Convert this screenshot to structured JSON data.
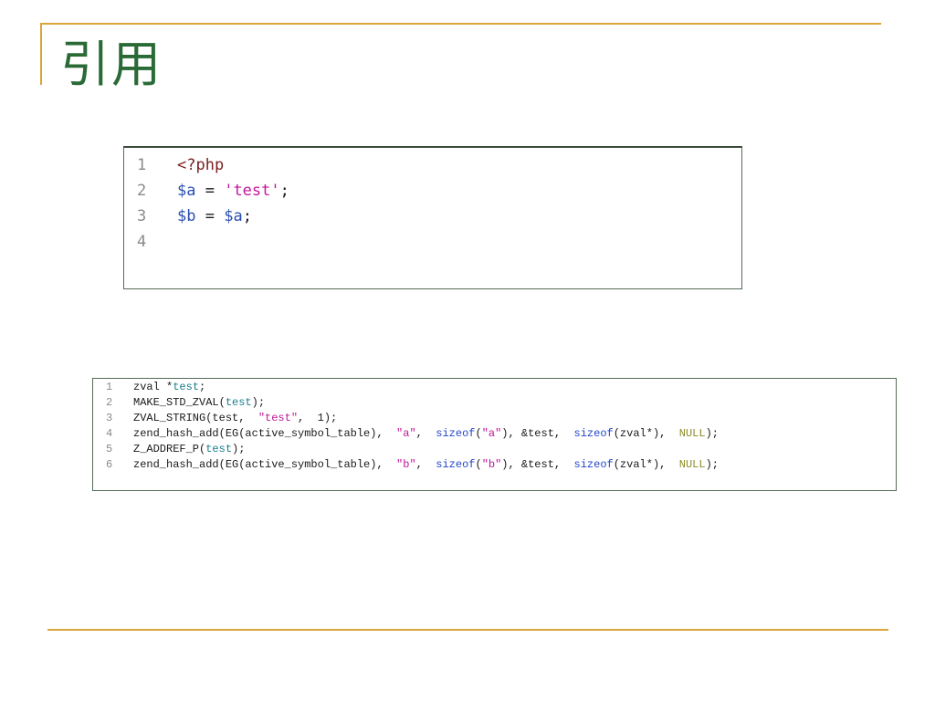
{
  "slide": {
    "title": "引用"
  },
  "php_snippet": {
    "lines": [
      {
        "num": "1",
        "tokens": [
          {
            "t": "<?php",
            "c": "php"
          }
        ]
      },
      {
        "num": "2",
        "tokens": [
          {
            "t": "$a",
            "c": "var"
          },
          {
            "t": " = ",
            "c": "op"
          },
          {
            "t": "'test'",
            "c": "str"
          },
          {
            "t": ";",
            "c": "op"
          }
        ]
      },
      {
        "num": "3",
        "tokens": [
          {
            "t": "$b",
            "c": "var"
          },
          {
            "t": " = ",
            "c": "op"
          },
          {
            "t": "$a",
            "c": "var"
          },
          {
            "t": ";",
            "c": "op"
          }
        ]
      },
      {
        "num": "4",
        "tokens": []
      }
    ]
  },
  "c_snippet": {
    "lines": [
      {
        "num": "1",
        "tokens": [
          {
            "t": "zval *",
            "c": "plain"
          },
          {
            "t": "test",
            "c": "id"
          },
          {
            "t": ";",
            "c": "plain"
          }
        ]
      },
      {
        "num": "2",
        "tokens": [
          {
            "t": "MAKE_STD_ZVAL(",
            "c": "plain"
          },
          {
            "t": "test",
            "c": "id"
          },
          {
            "t": ");",
            "c": "plain"
          }
        ]
      },
      {
        "num": "3",
        "tokens": [
          {
            "t": "ZVAL_STRING(test,  ",
            "c": "plain"
          },
          {
            "t": "\"test\"",
            "c": "str"
          },
          {
            "t": ",  1);",
            "c": "plain"
          }
        ]
      },
      {
        "num": "4",
        "tokens": [
          {
            "t": "zend_hash_add(EG(active_symbol_table),  ",
            "c": "plain"
          },
          {
            "t": "\"a\"",
            "c": "str"
          },
          {
            "t": ",  ",
            "c": "plain"
          },
          {
            "t": "sizeof",
            "c": "kw"
          },
          {
            "t": "(",
            "c": "plain"
          },
          {
            "t": "\"a\"",
            "c": "str"
          },
          {
            "t": "), &test,  ",
            "c": "plain"
          },
          {
            "t": "sizeof",
            "c": "kw"
          },
          {
            "t": "(zval*),  ",
            "c": "plain"
          },
          {
            "t": "NULL",
            "c": "null"
          },
          {
            "t": ");",
            "c": "plain"
          }
        ]
      },
      {
        "num": "5",
        "tokens": [
          {
            "t": "Z_ADDREF_P(",
            "c": "plain"
          },
          {
            "t": "test",
            "c": "id"
          },
          {
            "t": ");",
            "c": "plain"
          }
        ]
      },
      {
        "num": "6",
        "tokens": [
          {
            "t": "zend_hash_add(EG(active_symbol_table),  ",
            "c": "plain"
          },
          {
            "t": "\"b\"",
            "c": "str"
          },
          {
            "t": ",  ",
            "c": "plain"
          },
          {
            "t": "sizeof",
            "c": "kw"
          },
          {
            "t": "(",
            "c": "plain"
          },
          {
            "t": "\"b\"",
            "c": "str"
          },
          {
            "t": "), &test,  ",
            "c": "plain"
          },
          {
            "t": "sizeof",
            "c": "kw"
          },
          {
            "t": "(zval*),  ",
            "c": "plain"
          },
          {
            "t": "NULL",
            "c": "null"
          },
          {
            "t": ");",
            "c": "plain"
          }
        ]
      }
    ]
  },
  "colors": {
    "accent_rule": "#d9a53a",
    "title": "#2a6a36",
    "string": "#c2169b",
    "variable": "#2a4fb0",
    "keyword": "#2246c8",
    "null": "#8c8c2a"
  }
}
